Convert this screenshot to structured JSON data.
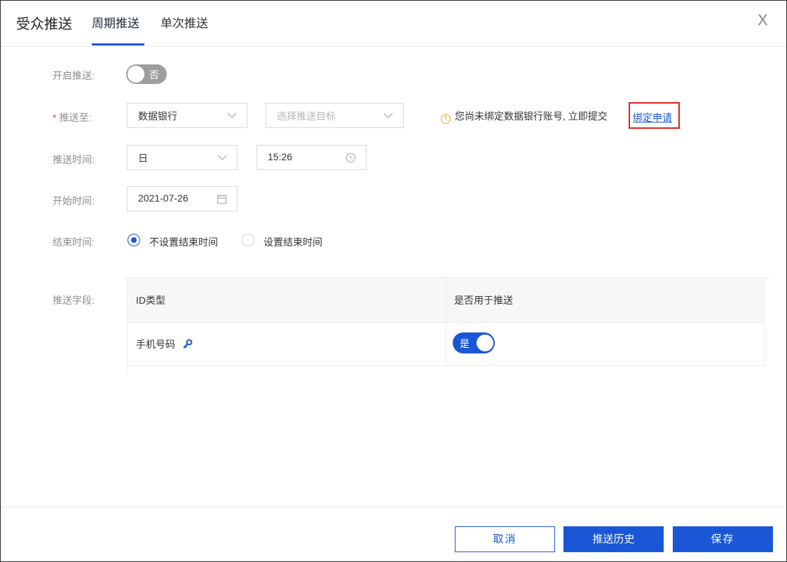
{
  "header": {
    "title": "受众推送",
    "tabs": [
      {
        "label": "周期推送",
        "active": true
      },
      {
        "label": "单次推送",
        "active": false
      }
    ],
    "close_glyph": "X"
  },
  "form": {
    "enable_push": {
      "label": "开启推送:",
      "toggle_text": "否",
      "on": false
    },
    "push_to": {
      "required_mark": "*",
      "label": "推送至:",
      "source_value": "数据银行",
      "target_placeholder": "选择推送目标",
      "warning_text": "您尚未绑定数据银行账号, 立即提交",
      "warning_link": "绑定申请"
    },
    "push_time": {
      "label": "推送时间:",
      "period_value": "日",
      "time_value": "15:26"
    },
    "start_time": {
      "label": "开始时间:",
      "date_value": "2021-07-26"
    },
    "end_time": {
      "label": "结束时间:",
      "options": [
        {
          "label": "不设置结束时间",
          "selected": true
        },
        {
          "label": "设置结束时间",
          "selected": false
        }
      ]
    },
    "push_fields": {
      "label": "推送字段:",
      "columns": [
        "ID类型",
        "是否用于推送"
      ],
      "rows": [
        {
          "id_type": "手机号码",
          "icon": "key-icon",
          "toggle_text": "是",
          "enabled": true
        }
      ]
    }
  },
  "footer": {
    "cancel_label": "取消",
    "history_label": "推送历史",
    "save_label": "保存"
  },
  "colors": {
    "accent": "#1a57d6",
    "warning": "#f5a623",
    "highlight_box": "#e02020"
  }
}
